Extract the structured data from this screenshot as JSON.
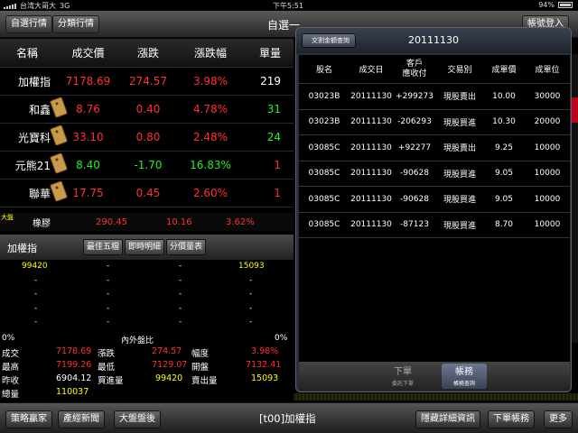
{
  "statusbar": {
    "carrier": "台湾大哥大",
    "network": "3G",
    "time": "下午5:51",
    "battery": "94%"
  },
  "topbar": {
    "btn_watchlist": "自選行情",
    "btn_category": "分類行情",
    "title": "自選一",
    "btn_right": "帳號登入"
  },
  "quotes": {
    "headers": [
      "名稱",
      "成交價",
      "漲跌",
      "漲跌幅",
      "單量"
    ],
    "rows": [
      {
        "name": "加權指",
        "price": "7178.69",
        "change": "274.57",
        "pct": "3.98%",
        "vol": "219",
        "color": "red",
        "vol_color": "white"
      },
      {
        "name": "和鑫",
        "price": "8.76",
        "change": "0.40",
        "pct": "4.78%",
        "vol": "31",
        "color": "red",
        "vol_color": "green"
      },
      {
        "name": "光寶科",
        "price": "33.10",
        "change": "0.80",
        "pct": "2.48%",
        "vol": "24",
        "color": "red",
        "vol_color": "green"
      },
      {
        "name": "元熊21",
        "price": "8.40",
        "change": "-1.70",
        "pct": "16.83%",
        "vol": "1",
        "color": "green",
        "vol_color": "red"
      },
      {
        "name": "聯華",
        "price": "17.75",
        "change": "0.45",
        "pct": "2.60%",
        "vol": "1",
        "color": "red",
        "vol_color": "red"
      }
    ],
    "ticker": {
      "label": "大盤",
      "name": "橡膠",
      "price": "290.45",
      "change": "10.16",
      "pct": "3.62%"
    }
  },
  "detail": {
    "title": "加權指",
    "tabs": [
      "最佳五檔",
      "即時明細",
      "分價量表"
    ],
    "book_top": {
      "bid_vol": "99420",
      "bid": "-",
      "ask": "-",
      "ask_vol": "15093"
    },
    "book_dash": "-",
    "ratio": {
      "left": "0%",
      "label": "內外盤比",
      "right": "0%"
    },
    "stats": [
      [
        "成交",
        "7178.69",
        "漲跌",
        "274.57",
        "幅度",
        "3.98%"
      ],
      [
        "最高",
        "7199.26",
        "最低",
        "7129.07",
        "開盤",
        "7132.41"
      ],
      [
        "昨收",
        "6904.12",
        "買進量",
        "99420",
        "賣出量",
        "15093"
      ],
      [
        "總量",
        "110037",
        "",
        "",
        "",
        ""
      ]
    ]
  },
  "popover": {
    "back_btn": "交割金額查詢",
    "date": "20111130",
    "headers": [
      "股名",
      "成交日",
      "客戶\n應收付",
      "交易別",
      "成單價",
      "成單位"
    ],
    "rows": [
      [
        "03023B",
        "20111130",
        "+299273",
        "現股賣出",
        "10.00",
        "30000"
      ],
      [
        "03023B",
        "20111130",
        "-206293",
        "現股買進",
        "10.30",
        "20000"
      ],
      [
        "03085C",
        "20111130",
        "+92277",
        "現股賣出",
        "9.25",
        "10000"
      ],
      [
        "03085C",
        "20111130",
        "-90628",
        "現股買進",
        "9.05",
        "10000"
      ],
      [
        "03085C",
        "20111130",
        "-90628",
        "現股買進",
        "9.05",
        "10000"
      ],
      [
        "03085C",
        "20111130",
        "-87123",
        "現股買進",
        "8.70",
        "10000"
      ]
    ],
    "footer": [
      {
        "label": "下單",
        "sub": "委託下單"
      },
      {
        "label": "帳務",
        "sub": "帳務查詢"
      }
    ]
  },
  "bottombar": {
    "btn_strategy": "策略贏家",
    "btn_news": "產經新聞",
    "btn_after": "大盤盤後",
    "title": "[t00]加權指",
    "btn_hide": "隱藏詳細資訊",
    "btn_order": "下單帳務",
    "btn_more": "更多"
  },
  "colors": {
    "up": "#ff3030",
    "down": "#22ee22",
    "accent": "#ffff00"
  }
}
